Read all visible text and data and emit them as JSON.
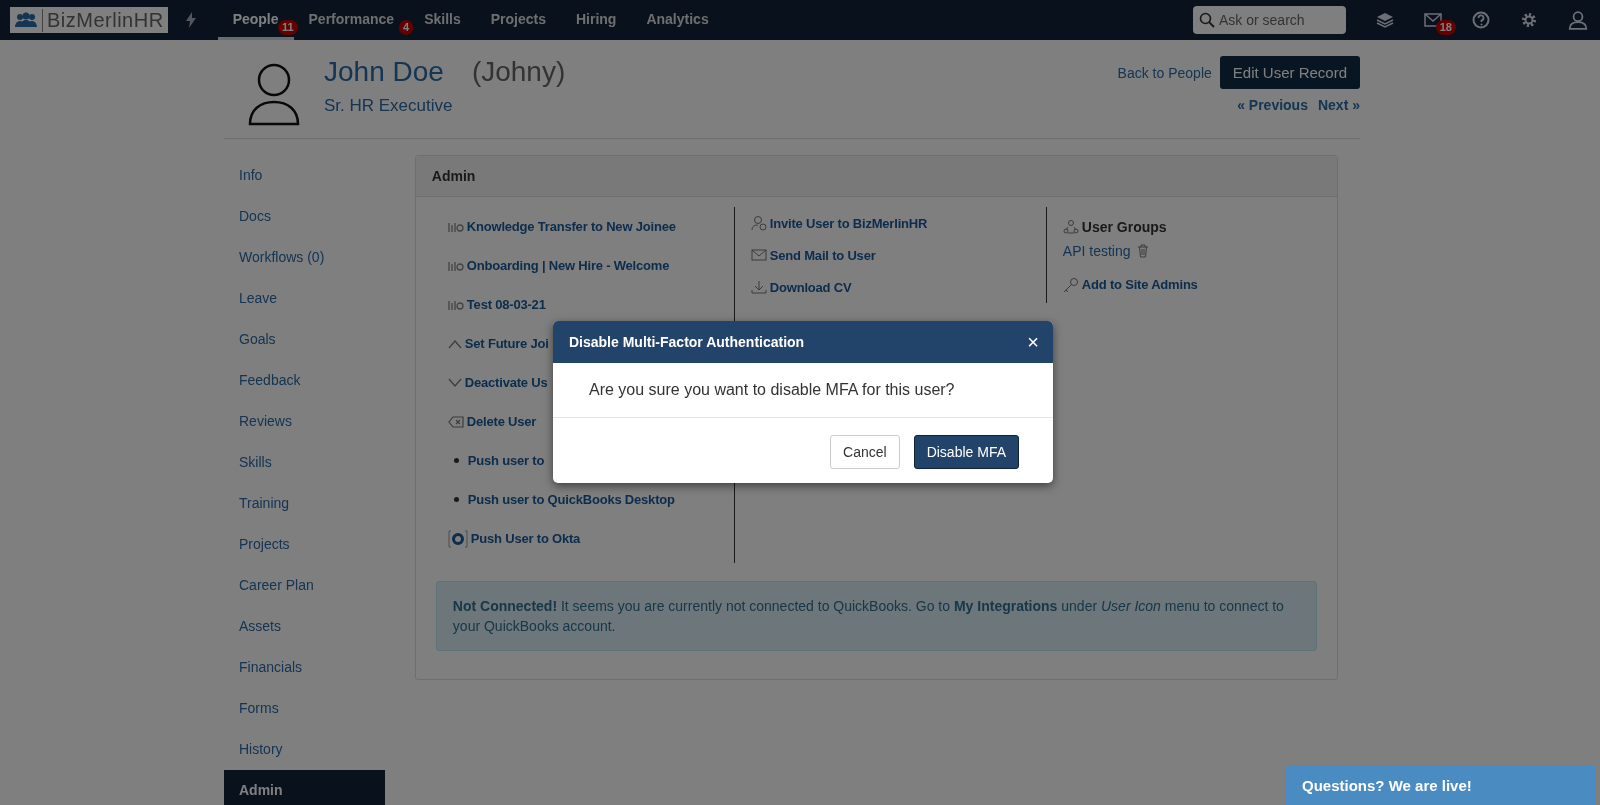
{
  "nav": {
    "logo": "BizMerlinHR",
    "tabs": [
      {
        "label": "People",
        "selected": true,
        "badge": "11"
      },
      {
        "label": "Performance",
        "selected": false,
        "badge": "4"
      },
      {
        "label": "Skills",
        "selected": false
      },
      {
        "label": "Projects",
        "selected": false
      },
      {
        "label": "Hiring",
        "selected": false
      },
      {
        "label": "Analytics",
        "selected": false
      }
    ],
    "search": {
      "placeholder": "Ask or search"
    },
    "mail_badge": "18"
  },
  "profile": {
    "name": "John Doe",
    "nickname": "(Johny)",
    "title": "Sr. HR Executive",
    "back_link": "Back to People",
    "edit_button": "Edit User Record",
    "previous": "« Previous",
    "next": "Next »"
  },
  "sidebar": {
    "items": [
      {
        "label": "Info",
        "selected": false
      },
      {
        "label": "Docs",
        "selected": false
      },
      {
        "label": "Workflows (0)",
        "selected": false
      },
      {
        "label": "Leave",
        "selected": false
      },
      {
        "label": "Goals",
        "selected": false
      },
      {
        "label": "Feedback",
        "selected": false
      },
      {
        "label": "Reviews",
        "selected": false
      },
      {
        "label": "Skills",
        "selected": false
      },
      {
        "label": "Training",
        "selected": false
      },
      {
        "label": "Projects",
        "selected": false
      },
      {
        "label": "Career Plan",
        "selected": false
      },
      {
        "label": "Assets",
        "selected": false
      },
      {
        "label": "Financials",
        "selected": false
      },
      {
        "label": "Forms",
        "selected": false
      },
      {
        "label": "History",
        "selected": false
      },
      {
        "label": "Admin",
        "selected": true
      }
    ]
  },
  "admin": {
    "title": "Admin",
    "column_1": [
      {
        "kind": "workflow",
        "label": "Knowledge Transfer to New Joinee"
      },
      {
        "kind": "workflow",
        "label": "Onboarding | New Hire - Welcome"
      },
      {
        "kind": "workflow",
        "label": "Test 08-03-21"
      },
      {
        "kind": "up",
        "label": "Set Future Joi"
      },
      {
        "kind": "down",
        "label": "Deactivate Us"
      },
      {
        "kind": "delete",
        "label": "Delete User"
      },
      {
        "kind": "bullet",
        "label": "Push user to"
      },
      {
        "kind": "bullet",
        "label": "Push user to QuickBooks Desktop"
      },
      {
        "kind": "okta",
        "label": "Push User to Okta"
      }
    ],
    "column_2": [
      {
        "kind": "invite",
        "label": "Invite User to BizMerlinHR"
      },
      {
        "kind": "mail",
        "label": "Send Mail to User"
      },
      {
        "kind": "download",
        "label": "Download CV"
      }
    ],
    "user_groups": {
      "heading": "User Groups",
      "groups": [
        "API testing"
      ]
    },
    "site_admins_link": "Add to Site Admins",
    "alert": "**Not Connected!** It seems you are currently not connected to QuickBooks. Go to **My Integrations** under *User Icon* menu to connect to your QuickBooks account."
  },
  "modal": {
    "title": "Disable Multi-Factor Authentication",
    "close": "×",
    "message": "Are you sure you want to disable MFA for this user?",
    "buttons": [
      {
        "kind": "secondary",
        "label": "Cancel"
      },
      {
        "kind": "primary",
        "label": "Disable MFA"
      }
    ]
  },
  "chat": {
    "label": "Questions? We are live!"
  }
}
